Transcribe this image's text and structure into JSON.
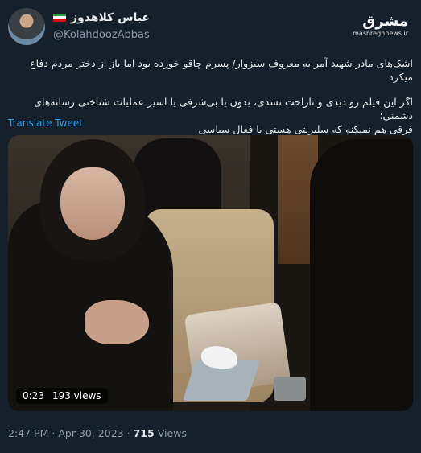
{
  "header": {
    "display_name": "عباس کلاهدوز",
    "handle": "@KolahdoozAbbas",
    "watermark_main": "مشرق",
    "watermark_sub": "mashreghnews.ir"
  },
  "tweet": {
    "line1": "اشک‌های مادر شهید آمر به معروف سبزوار/ پسرم چاقو خورده بود اما باز از دختر مردم دفاع میکرد",
    "line2": "اگر این فیلم رو دیدی و ناراحت نشدی، بدون یا بی‌شرفی یا اسیر عملیات شناختی رسانه‌های دشمنی؛",
    "line3": "فرقی هم نمیکنه که سلبریتی هستی یا فعال سیاسی",
    "translate_label": "Translate Tweet"
  },
  "video": {
    "time": "0:23",
    "views": "193 views"
  },
  "footer": {
    "time": "2:47 PM",
    "date": "Apr 30, 2023",
    "views_count": "715",
    "views_label": "Views"
  },
  "colors": {
    "background": "#15202b",
    "link": "#1d9bf0",
    "secondary_text": "#8b98a5"
  }
}
